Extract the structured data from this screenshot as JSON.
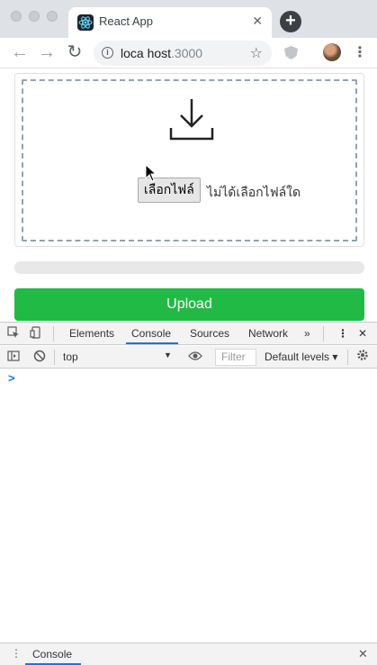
{
  "browser": {
    "tab_title": "React App",
    "tab_close": "✕",
    "new_tab": "+",
    "url_host": "loca host",
    "url_port": ".3000",
    "info_symbol": "i",
    "back": "←",
    "forward": "→",
    "reload": "↻",
    "star": "☆",
    "menu": "⋮"
  },
  "page": {
    "choose_file_label": "เลือกไฟล์",
    "no_file_text": "ไม่ได้เลือกไฟล์ใด",
    "upload_label": "Upload",
    "progress_fraction": 0,
    "accent": "#21ba45"
  },
  "devtools": {
    "tabs": [
      "Elements",
      "Console",
      "Sources",
      "Network"
    ],
    "more": "»",
    "menu": "⋮",
    "close": "✕",
    "context": "top",
    "context_arrow": "▼",
    "filter_placeholder": "Filter",
    "levels": "Default levels ▾",
    "prompt": ">",
    "drawer_tab": "Console",
    "drawer_dots": "⋮",
    "drawer_close": "✕"
  },
  "icons": [
    "inspect-icon",
    "device-icon",
    "sidebar-toggle-icon",
    "clear-console-icon",
    "eye-icon",
    "gear-icon",
    "download-icon",
    "react-favicon-icon",
    "extension-icon",
    "avatar"
  ]
}
